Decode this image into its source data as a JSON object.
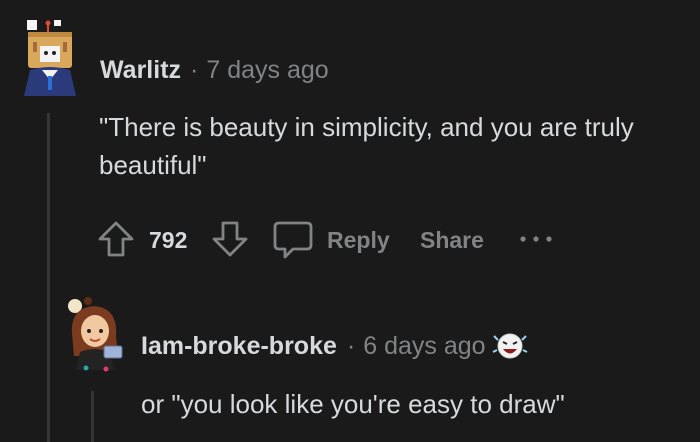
{
  "comment1": {
    "username": "Warlitz",
    "separator": "·",
    "time": "7 days ago",
    "text": "\"There is beauty in simplicity, and you are truly beautiful\"",
    "score": "792",
    "reply_label": "Reply",
    "share_label": "Share",
    "more_label": "•••"
  },
  "comment2": {
    "username": "Iam-broke-broke",
    "separator": "·",
    "time": "6 days ago",
    "text": "or \"you look like you're easy to draw\""
  },
  "icons": {
    "upvote": "arrow-up-outline-icon",
    "downvote": "arrow-down-outline-icon",
    "reply": "speech-bubble-icon",
    "more": "ellipsis-icon",
    "award": "laughing-award-icon"
  },
  "colors": {
    "background": "#1a1a1b",
    "text": "#d7dadc",
    "muted": "#818384",
    "thread_line": "#343536"
  }
}
